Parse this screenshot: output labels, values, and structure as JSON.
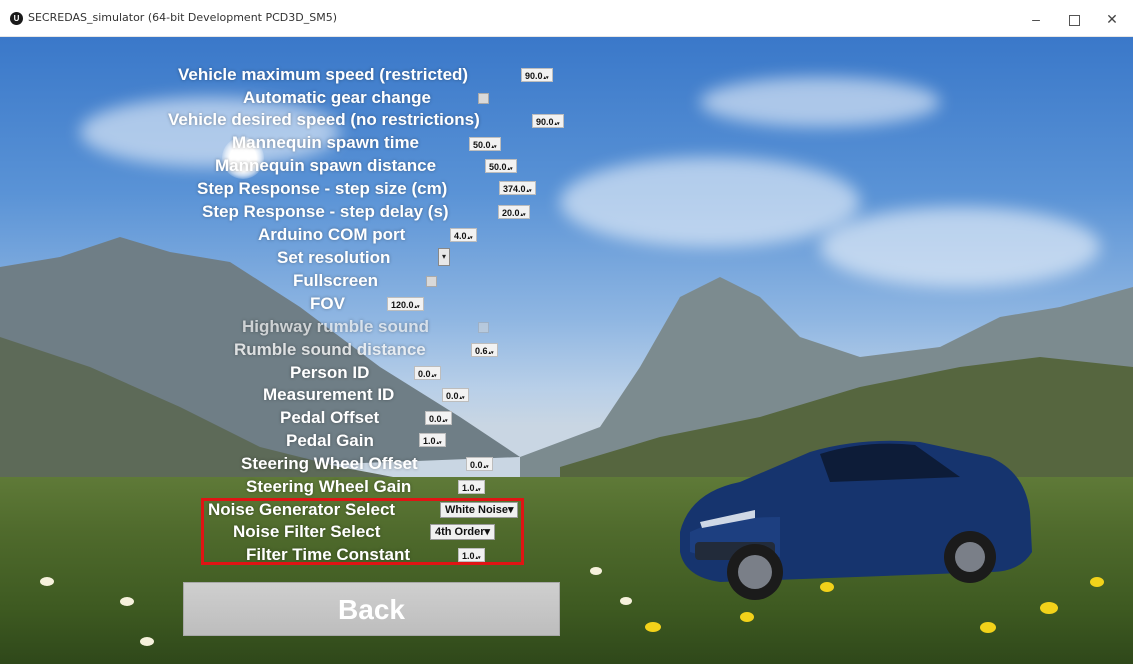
{
  "window": {
    "title": "SECREDAS_simulator (64-bit Development PCD3D_SM5)",
    "minimize": "–",
    "close": "✕"
  },
  "settings": {
    "vehicle_max_speed": {
      "label": "Vehicle maximum speed (restricted)",
      "value": "90.0"
    },
    "automatic_gear": {
      "label": "Automatic gear change"
    },
    "desired_speed": {
      "label": "Vehicle desired speed (no restrictions)",
      "value": "90.0"
    },
    "mannequin_time": {
      "label": "Mannequin spawn time",
      "value": "50.0"
    },
    "mannequin_distance": {
      "label": "Mannequin spawn distance",
      "value": "50.0"
    },
    "step_size": {
      "label": "Step Response - step size (cm)",
      "value": "374.0"
    },
    "step_delay": {
      "label": "Step Response - step delay (s)",
      "value": "20.0"
    },
    "arduino_port": {
      "label": "Arduino COM port",
      "value": "4.0"
    },
    "resolution": {
      "label": "Set resolution"
    },
    "fullscreen": {
      "label": "Fullscreen"
    },
    "fov": {
      "label": "FOV",
      "value": "120.0"
    },
    "rumble_sound": {
      "label": "Highway rumble sound"
    },
    "rumble_distance": {
      "label": "Rumble sound distance",
      "value": "0.6"
    },
    "person_id": {
      "label": "Person ID",
      "value": "0.0"
    },
    "measurement_id": {
      "label": "Measurement ID",
      "value": "0.0"
    },
    "pedal_offset": {
      "label": "Pedal Offset",
      "value": "0.0"
    },
    "pedal_gain": {
      "label": "Pedal Gain",
      "value": "1.0"
    },
    "steering_offset": {
      "label": "Steering Wheel Offset",
      "value": "0.0"
    },
    "steering_gain": {
      "label": "Steering Wheel Gain",
      "value": "1.0"
    },
    "noise_generator": {
      "label": "Noise Generator Select",
      "value": "White Noise"
    },
    "noise_filter": {
      "label": "Noise Filter Select",
      "value": "4th Order"
    },
    "filter_time": {
      "label": "Filter Time Constant",
      "value": "1.0"
    }
  },
  "back_button": {
    "label": "Back"
  },
  "colors": {
    "highlight": "#e01414",
    "button": "#c8c8c8"
  }
}
